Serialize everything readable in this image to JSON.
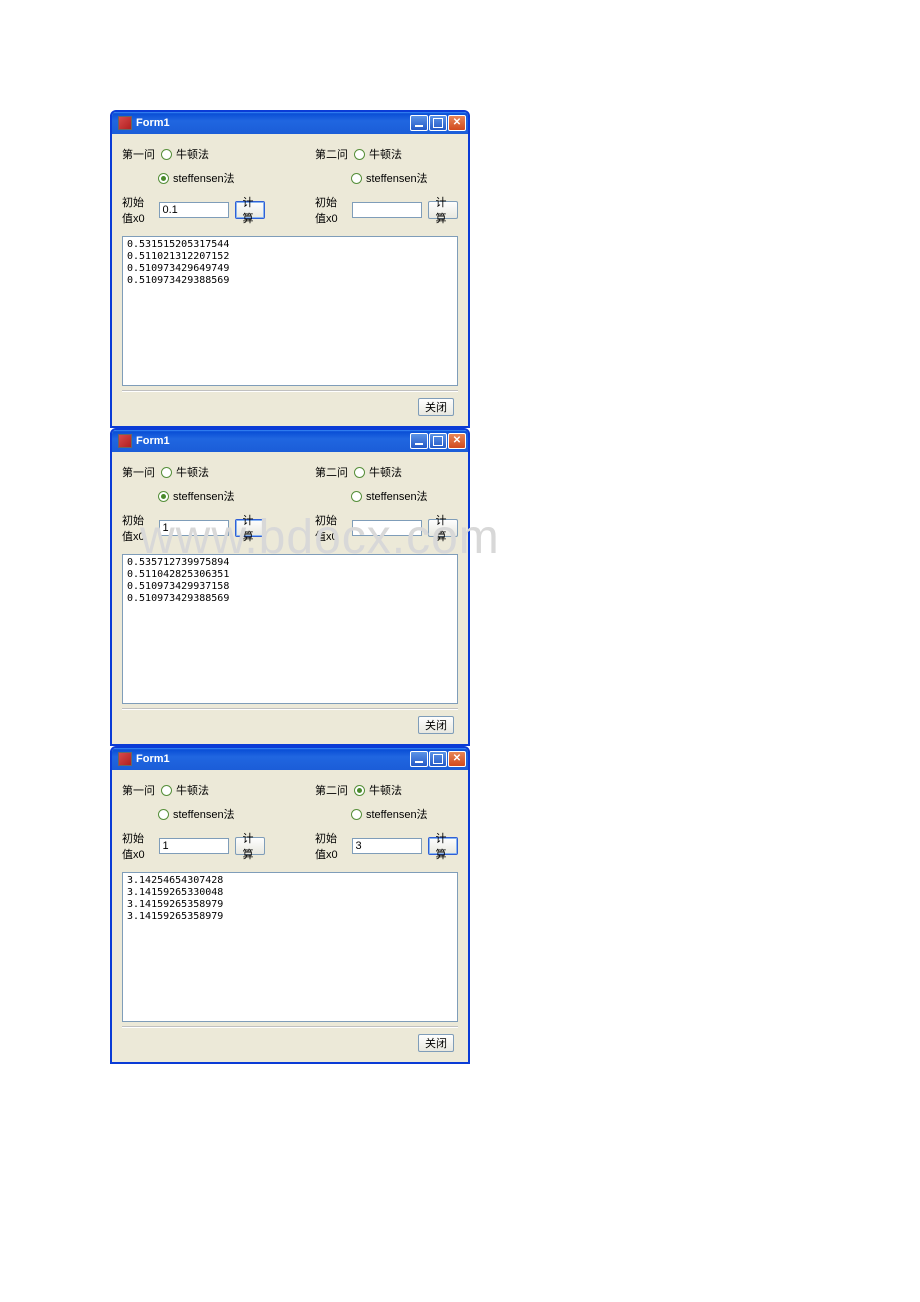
{
  "watermark": "www.bdocx.com",
  "windows": [
    {
      "title": "Form1",
      "q1": {
        "label": "第一问",
        "radio_newton": "牛顿法",
        "radio_steffensen": "steffensen法",
        "selected": "steffensen",
        "x0_label": "初始值x0",
        "x0_value": "0.1",
        "compute": "计算",
        "compute_focused": true
      },
      "q2": {
        "label": "第二问",
        "radio_newton": "牛顿法",
        "radio_steffensen": "steffensen法",
        "selected": "none",
        "x0_label": "初始值x0",
        "x0_value": "",
        "compute": "计算",
        "compute_focused": false
      },
      "output": "0.531515205317544\n0.511021312207152\n0.510973429649749\n0.510973429388569",
      "close_btn": "关闭"
    },
    {
      "title": "Form1",
      "q1": {
        "label": "第一问",
        "radio_newton": "牛顿法",
        "radio_steffensen": "steffensen法",
        "selected": "steffensen",
        "x0_label": "初始值x0",
        "x0_value": "1",
        "compute": "计算",
        "compute_focused": true
      },
      "q2": {
        "label": "第二问",
        "radio_newton": "牛顿法",
        "radio_steffensen": "steffensen法",
        "selected": "none",
        "x0_label": "初始值x0",
        "x0_value": "",
        "compute": "计算",
        "compute_focused": false
      },
      "output": "0.535712739975894\n0.511042825306351\n0.510973429937158\n0.510973429388569",
      "close_btn": "关闭"
    },
    {
      "title": "Form1",
      "q1": {
        "label": "第一问",
        "radio_newton": "牛顿法",
        "radio_steffensen": "steffensen法",
        "selected": "none",
        "x0_label": "初始值x0",
        "x0_value": "1",
        "compute": "计算",
        "compute_focused": false
      },
      "q2": {
        "label": "第二问",
        "radio_newton": "牛顿法",
        "radio_steffensen": "steffensen法",
        "selected": "newton",
        "x0_label": "初始值x0",
        "x0_value": "3",
        "compute": "计算",
        "compute_focused": true
      },
      "output": "3.14254654307428\n3.14159265330048\n3.14159265358979\n3.14159265358979",
      "close_btn": "关闭"
    }
  ]
}
